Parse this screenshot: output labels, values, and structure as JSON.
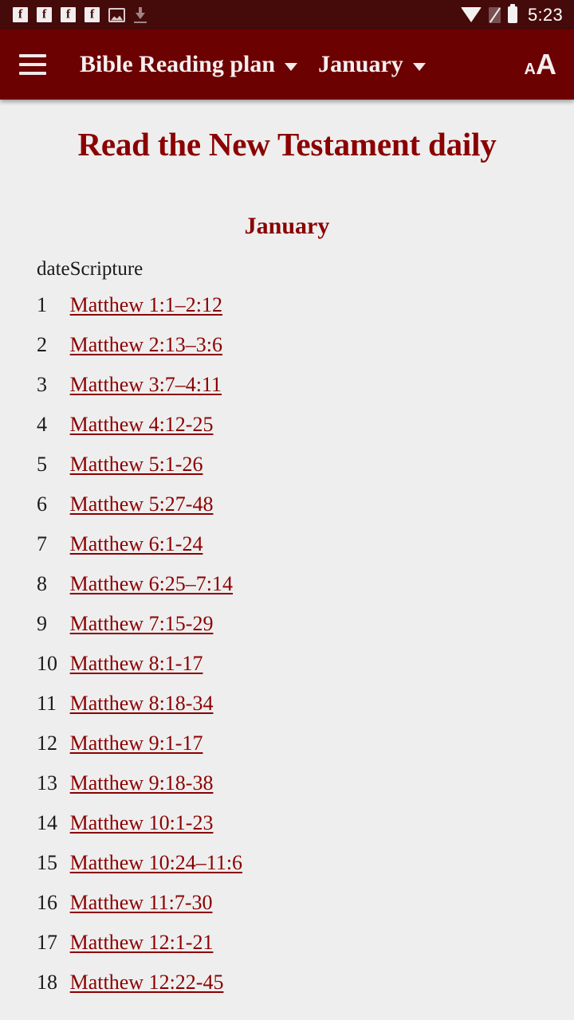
{
  "status_bar": {
    "time": "5:23",
    "left_icons": [
      {
        "name": "facebook-notification-icon"
      },
      {
        "name": "facebook-notification-icon"
      },
      {
        "name": "facebook-notification-icon"
      },
      {
        "name": "facebook-notification-icon"
      },
      {
        "name": "image-notification-icon"
      },
      {
        "name": "download-notification-icon"
      }
    ],
    "right_icons": [
      {
        "name": "wifi-icon"
      },
      {
        "name": "no-sim-icon"
      },
      {
        "name": "battery-icon"
      }
    ],
    "background_color": "#450a0a"
  },
  "toolbar": {
    "menu_icon": "hamburger-menu-icon",
    "app_title": "Bible Reading plan",
    "month_selector": "January",
    "text_size_small": "A",
    "text_size_large": "A",
    "background_color": "#6b0101",
    "text_color": "#f7efef"
  },
  "content": {
    "page_title": "Read the New Testament daily",
    "month_heading": "January",
    "accent_color": "#8b0000",
    "background_color": "#eeeeee",
    "table": {
      "headers": {
        "date": "date",
        "scripture": "Scripture"
      },
      "rows": [
        {
          "date": "1",
          "scripture": "Matthew 1:1–2:12"
        },
        {
          "date": "2",
          "scripture": "Matthew 2:13–3:6"
        },
        {
          "date": "3",
          "scripture": "Matthew 3:7–4:11"
        },
        {
          "date": "4",
          "scripture": "Matthew 4:12-25"
        },
        {
          "date": "5",
          "scripture": "Matthew 5:1-26"
        },
        {
          "date": "6",
          "scripture": "Matthew 5:27-48"
        },
        {
          "date": "7",
          "scripture": "Matthew 6:1-24"
        },
        {
          "date": "8",
          "scripture": "Matthew 6:25–7:14"
        },
        {
          "date": "9",
          "scripture": "Matthew 7:15-29"
        },
        {
          "date": "10",
          "scripture": "Matthew 8:1-17"
        },
        {
          "date": "11",
          "scripture": "Matthew 8:18-34"
        },
        {
          "date": "12",
          "scripture": "Matthew 9:1-17"
        },
        {
          "date": "13",
          "scripture": "Matthew 9:18-38"
        },
        {
          "date": "14",
          "scripture": "Matthew 10:1-23"
        },
        {
          "date": "15",
          "scripture": "Matthew 10:24–11:6"
        },
        {
          "date": "16",
          "scripture": "Matthew 11:7-30"
        },
        {
          "date": "17",
          "scripture": "Matthew 12:1-21"
        },
        {
          "date": "18",
          "scripture": "Matthew 12:22-45"
        }
      ]
    }
  }
}
